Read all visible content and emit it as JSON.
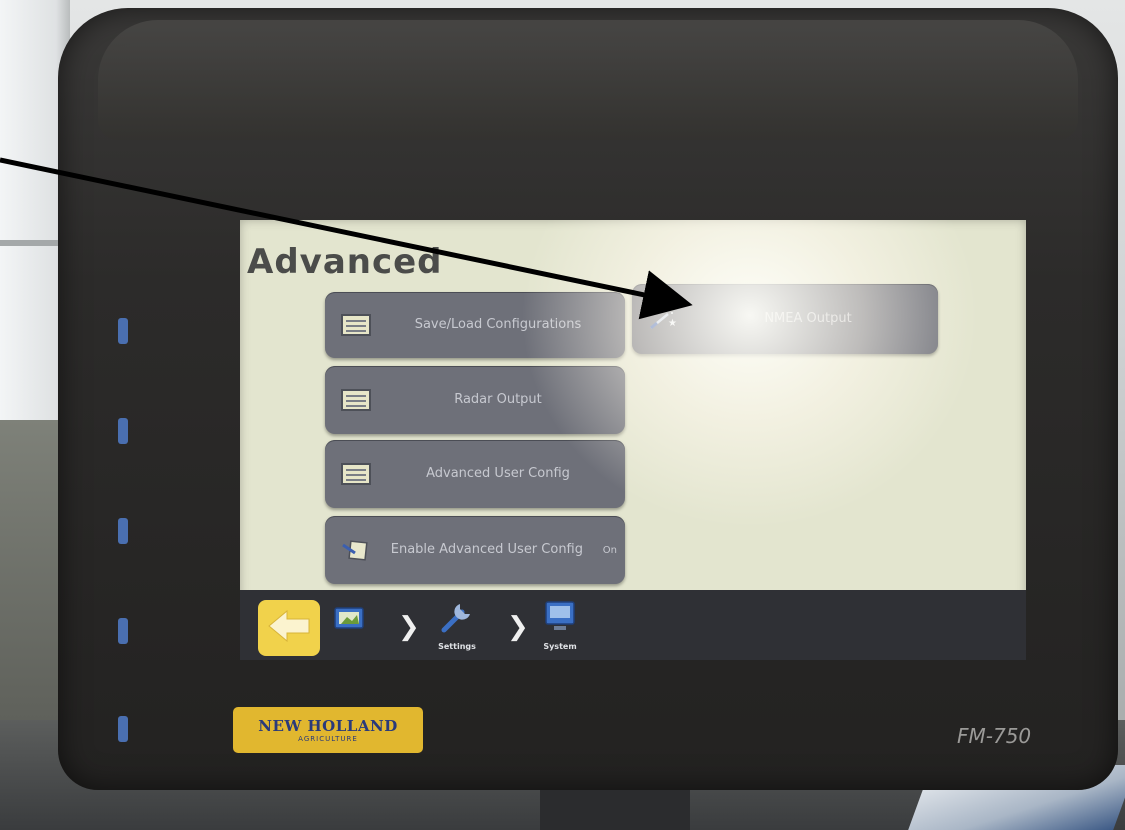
{
  "screen": {
    "title": "Advanced",
    "buttons": [
      {
        "label": "Save/Load Configurations",
        "icon": "list-icon"
      },
      {
        "label": "NMEA Output",
        "icon": "magic-wand-icon"
      },
      {
        "label": "Radar Output",
        "icon": "list-icon"
      },
      {
        "label": "Advanced User Config",
        "icon": "list-icon"
      },
      {
        "label": "Enable Advanced User Config",
        "icon": "edit-icon",
        "state": "On"
      }
    ]
  },
  "nav": {
    "back_icon": "back-arrow-icon",
    "crumbs": [
      {
        "label": "",
        "icon": "home-display-icon"
      },
      {
        "label": "Settings",
        "icon": "wrench-icon"
      },
      {
        "label": "System",
        "icon": "display-icon"
      }
    ]
  },
  "device": {
    "brand": "NEW HOLLAND",
    "brand_sub": "AGRICULTURE",
    "model": "FM-750"
  },
  "colors": {
    "screen_bg": "#e3e5cf",
    "button_bg": "#6e7079",
    "nav_bg": "#2f3035",
    "back_button": "#f1d24b",
    "bezel": "#2c2b2a",
    "brand_badge": "#e1b72f"
  },
  "annotation": {
    "type": "arrow",
    "target": "NMEA Output"
  }
}
